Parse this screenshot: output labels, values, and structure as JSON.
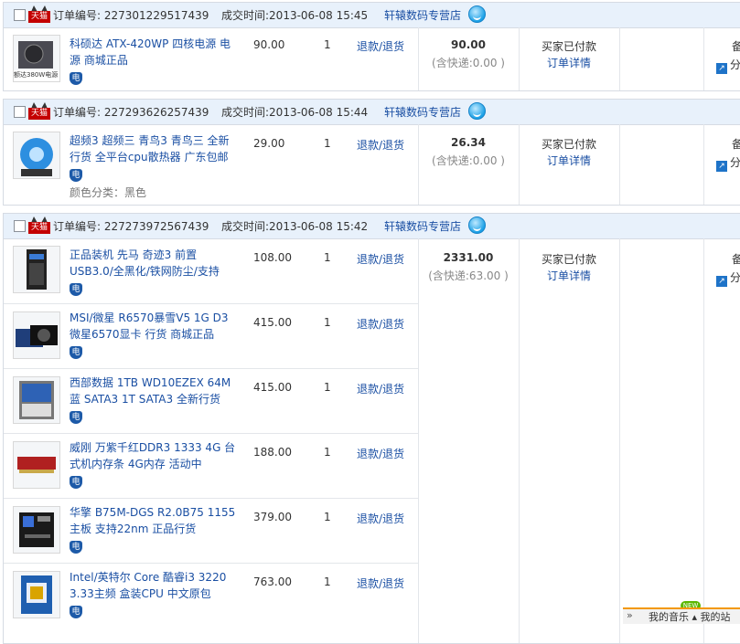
{
  "labels": {
    "order_no": "订单编号:",
    "deal_time": "成交时间:",
    "refund": "退款/退货",
    "status": "买家已付款",
    "detail": "订单详情",
    "tmall": "天猫",
    "dian": "电",
    "right_note": "备",
    "share": "分"
  },
  "orders": [
    {
      "order_no": "227301229517439",
      "time": "2013-06-08 15:45",
      "shop": "轩辕数码专营店",
      "total": "90.00",
      "shipping": "(含快递:0.00 )",
      "items": [
        {
          "name": "科硕达 ATX-420WP 四核电源 电源 商城正品",
          "price": "90.00",
          "qty": "1",
          "sku": "",
          "thumb_text": "额达380W电源"
        }
      ]
    },
    {
      "order_no": "227293626257439",
      "time": "2013-06-08 15:44",
      "shop": "轩辕数码专营店",
      "total": "26.34",
      "shipping": "(含快递:0.00 )",
      "items": [
        {
          "name": "超频3 超频三 青鸟3 青鸟三 全新行货 全平台cpu散热器 广东包邮",
          "price": "29.00",
          "qty": "1",
          "sku": "颜色分类：黑色",
          "thumb_text": ""
        }
      ]
    },
    {
      "order_no": "227273972567439",
      "time": "2013-06-08 15:42",
      "shop": "轩辕数码专营店",
      "total": "2331.00",
      "shipping": "(含快递:63.00 )",
      "items": [
        {
          "name": "正品装机 先马 奇迹3 前置USB3.0/全黑化/铁网防尘/支持",
          "price": "108.00",
          "qty": "1",
          "sku": "",
          "thumb_text": ""
        },
        {
          "name": "MSI/微星 R6570暴雪V5 1G D3 微星6570显卡 行货 商城正品",
          "price": "415.00",
          "qty": "1",
          "sku": "",
          "thumb_text": ""
        },
        {
          "name": "西部数据 1TB WD10EZEX 64M 蓝 SATA3 1T SATA3 全新行货",
          "price": "415.00",
          "qty": "1",
          "sku": "",
          "thumb_text": ""
        },
        {
          "name": "威刚 万紫千红DDR3 1333 4G 台式机内存条 4G内存 活动中",
          "price": "188.00",
          "qty": "1",
          "sku": "",
          "thumb_text": ""
        },
        {
          "name": "华擎 B75M-DGS R2.0B75 1155主板 支持22nm 正品行货",
          "price": "379.00",
          "qty": "1",
          "sku": "",
          "thumb_text": ""
        },
        {
          "name": "Intel/英特尔 Core 酷睿i3 3220 3.33主频 盒装CPU 中文原包",
          "price": "763.00",
          "qty": "1",
          "sku": "",
          "thumb_text": ""
        }
      ]
    }
  ],
  "music_bar": {
    "arrow": "»",
    "text": "我的音乐 ▴ 我的站",
    "badge": "NEW"
  },
  "colors": {
    "header_bg": "#e8f1fb",
    "link": "#1a4fa3",
    "tmall_red": "#c40000",
    "music_accent": "#f39800"
  }
}
